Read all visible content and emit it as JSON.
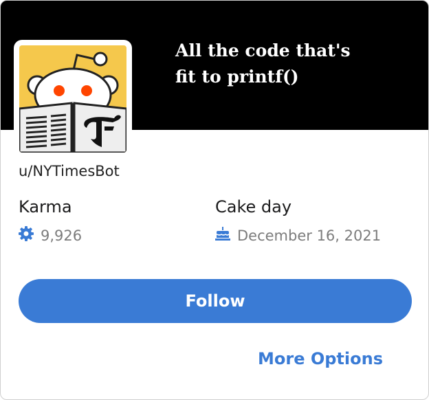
{
  "banner": {
    "line1": "All the code that's",
    "line2": "fit to printf()"
  },
  "profile": {
    "username": "u/NYTimesBot"
  },
  "stats": {
    "karma": {
      "label": "Karma",
      "value": "9,926",
      "icon": "karma-icon"
    },
    "cake_day": {
      "label": "Cake day",
      "value": "December 16, 2021",
      "icon": "cake-icon"
    }
  },
  "actions": {
    "follow_label": "Follow",
    "more_label": "More Options"
  },
  "colors": {
    "accent": "#3a7bd5",
    "banner": "#000000",
    "avatar_bg": "#f5c84c",
    "eye": "#ff4500"
  }
}
